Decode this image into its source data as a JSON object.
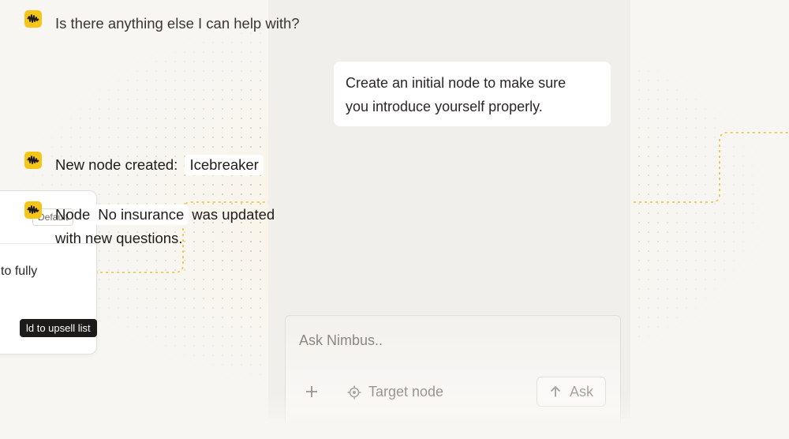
{
  "node_card": {
    "badge": "Default",
    "text": "ough to fully",
    "tag": "ld to upsell list"
  },
  "chat": {
    "messages": [
      {
        "role": "assistant",
        "text": "Is there anything else I can help with?"
      },
      {
        "role": "user",
        "line1": "Create an initial node to make sure",
        "line2": "you introduce yourself properly."
      },
      {
        "role": "assistant",
        "prefix": "New node created:",
        "chip": "Icebreaker"
      },
      {
        "role": "assistant",
        "prefix": "Node",
        "chip": "No insurance",
        "suffix": "was updated",
        "line2": "with new questions."
      }
    ]
  },
  "input": {
    "placeholder": "Ask Nimbus..",
    "target_label": "Target node",
    "ask_label": "Ask"
  },
  "colors": {
    "accent": "#f5c518",
    "connector": "#f0c238",
    "background": "#f8f6f2"
  },
  "icons": [
    "nimbus-logo-icon",
    "plus-icon",
    "target-icon",
    "arrow-up-icon"
  ]
}
